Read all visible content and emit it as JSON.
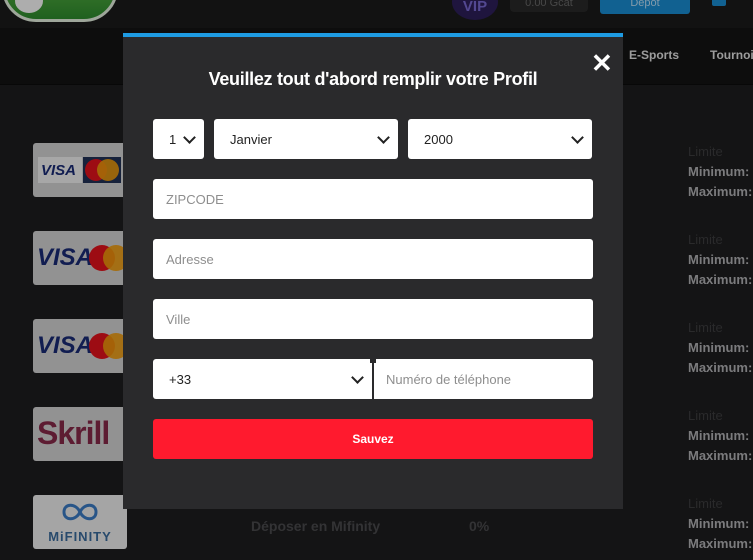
{
  "header": {
    "vip_label": "VIP",
    "balance_text": "0.00 Gcat",
    "deposit_label": "Dépôt"
  },
  "nav": {
    "items": [
      "E-Sports",
      "Tournoi"
    ]
  },
  "background": {
    "limit_title": "Limite",
    "minimum_label": "Minimum:",
    "maximum_label": "Maximum:",
    "methods": [
      "Visa / Mastercard",
      "Visa / Mastercard",
      "Visa / Mastercard",
      "Skrill",
      "MiFinity"
    ],
    "mifinity_logo_text": "MiFINITY",
    "skrill_logo_text": "Skrill",
    "visa_logo_text": "VISA",
    "last_row_label": "Déposer en Mifinity",
    "last_row_fee": "0%"
  },
  "modal": {
    "title": "Veuillez tout d'abord remplir votre Profil",
    "close_symbol": "✕",
    "day": "1",
    "month": "Janvier",
    "year": "2000",
    "zipcode_placeholder": "ZIPCODE",
    "address_placeholder": "Adresse",
    "city_placeholder": "Ville",
    "phone_code": "+33",
    "phone_placeholder": "Numéro de téléphone",
    "submit_label": "Sauvez"
  },
  "colors": {
    "accent_blue": "#1e9be3",
    "submit_red": "#ff1a2e",
    "modal_bg": "#2a2a2c"
  }
}
